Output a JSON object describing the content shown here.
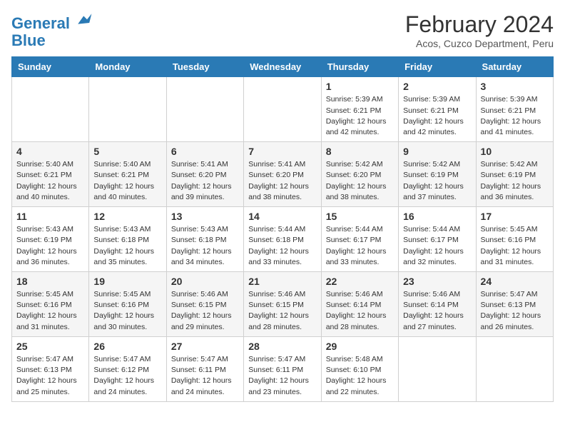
{
  "header": {
    "logo_line1": "General",
    "logo_line2": "Blue",
    "title": "February 2024",
    "subtitle": "Acos, Cuzco Department, Peru"
  },
  "days_of_week": [
    "Sunday",
    "Monday",
    "Tuesday",
    "Wednesday",
    "Thursday",
    "Friday",
    "Saturday"
  ],
  "weeks": [
    [
      {
        "day": "",
        "info": ""
      },
      {
        "day": "",
        "info": ""
      },
      {
        "day": "",
        "info": ""
      },
      {
        "day": "",
        "info": ""
      },
      {
        "day": "1",
        "info": "Sunrise: 5:39 AM\nSunset: 6:21 PM\nDaylight: 12 hours and 42 minutes."
      },
      {
        "day": "2",
        "info": "Sunrise: 5:39 AM\nSunset: 6:21 PM\nDaylight: 12 hours and 42 minutes."
      },
      {
        "day": "3",
        "info": "Sunrise: 5:39 AM\nSunset: 6:21 PM\nDaylight: 12 hours and 41 minutes."
      }
    ],
    [
      {
        "day": "4",
        "info": "Sunrise: 5:40 AM\nSunset: 6:21 PM\nDaylight: 12 hours and 40 minutes."
      },
      {
        "day": "5",
        "info": "Sunrise: 5:40 AM\nSunset: 6:21 PM\nDaylight: 12 hours and 40 minutes."
      },
      {
        "day": "6",
        "info": "Sunrise: 5:41 AM\nSunset: 6:20 PM\nDaylight: 12 hours and 39 minutes."
      },
      {
        "day": "7",
        "info": "Sunrise: 5:41 AM\nSunset: 6:20 PM\nDaylight: 12 hours and 38 minutes."
      },
      {
        "day": "8",
        "info": "Sunrise: 5:42 AM\nSunset: 6:20 PM\nDaylight: 12 hours and 38 minutes."
      },
      {
        "day": "9",
        "info": "Sunrise: 5:42 AM\nSunset: 6:19 PM\nDaylight: 12 hours and 37 minutes."
      },
      {
        "day": "10",
        "info": "Sunrise: 5:42 AM\nSunset: 6:19 PM\nDaylight: 12 hours and 36 minutes."
      }
    ],
    [
      {
        "day": "11",
        "info": "Sunrise: 5:43 AM\nSunset: 6:19 PM\nDaylight: 12 hours and 36 minutes."
      },
      {
        "day": "12",
        "info": "Sunrise: 5:43 AM\nSunset: 6:18 PM\nDaylight: 12 hours and 35 minutes."
      },
      {
        "day": "13",
        "info": "Sunrise: 5:43 AM\nSunset: 6:18 PM\nDaylight: 12 hours and 34 minutes."
      },
      {
        "day": "14",
        "info": "Sunrise: 5:44 AM\nSunset: 6:18 PM\nDaylight: 12 hours and 33 minutes."
      },
      {
        "day": "15",
        "info": "Sunrise: 5:44 AM\nSunset: 6:17 PM\nDaylight: 12 hours and 33 minutes."
      },
      {
        "day": "16",
        "info": "Sunrise: 5:44 AM\nSunset: 6:17 PM\nDaylight: 12 hours and 32 minutes."
      },
      {
        "day": "17",
        "info": "Sunrise: 5:45 AM\nSunset: 6:16 PM\nDaylight: 12 hours and 31 minutes."
      }
    ],
    [
      {
        "day": "18",
        "info": "Sunrise: 5:45 AM\nSunset: 6:16 PM\nDaylight: 12 hours and 31 minutes."
      },
      {
        "day": "19",
        "info": "Sunrise: 5:45 AM\nSunset: 6:16 PM\nDaylight: 12 hours and 30 minutes."
      },
      {
        "day": "20",
        "info": "Sunrise: 5:46 AM\nSunset: 6:15 PM\nDaylight: 12 hours and 29 minutes."
      },
      {
        "day": "21",
        "info": "Sunrise: 5:46 AM\nSunset: 6:15 PM\nDaylight: 12 hours and 28 minutes."
      },
      {
        "day": "22",
        "info": "Sunrise: 5:46 AM\nSunset: 6:14 PM\nDaylight: 12 hours and 28 minutes."
      },
      {
        "day": "23",
        "info": "Sunrise: 5:46 AM\nSunset: 6:14 PM\nDaylight: 12 hours and 27 minutes."
      },
      {
        "day": "24",
        "info": "Sunrise: 5:47 AM\nSunset: 6:13 PM\nDaylight: 12 hours and 26 minutes."
      }
    ],
    [
      {
        "day": "25",
        "info": "Sunrise: 5:47 AM\nSunset: 6:13 PM\nDaylight: 12 hours and 25 minutes."
      },
      {
        "day": "26",
        "info": "Sunrise: 5:47 AM\nSunset: 6:12 PM\nDaylight: 12 hours and 24 minutes."
      },
      {
        "day": "27",
        "info": "Sunrise: 5:47 AM\nSunset: 6:11 PM\nDaylight: 12 hours and 24 minutes."
      },
      {
        "day": "28",
        "info": "Sunrise: 5:47 AM\nSunset: 6:11 PM\nDaylight: 12 hours and 23 minutes."
      },
      {
        "day": "29",
        "info": "Sunrise: 5:48 AM\nSunset: 6:10 PM\nDaylight: 12 hours and 22 minutes."
      },
      {
        "day": "",
        "info": ""
      },
      {
        "day": "",
        "info": ""
      }
    ]
  ]
}
